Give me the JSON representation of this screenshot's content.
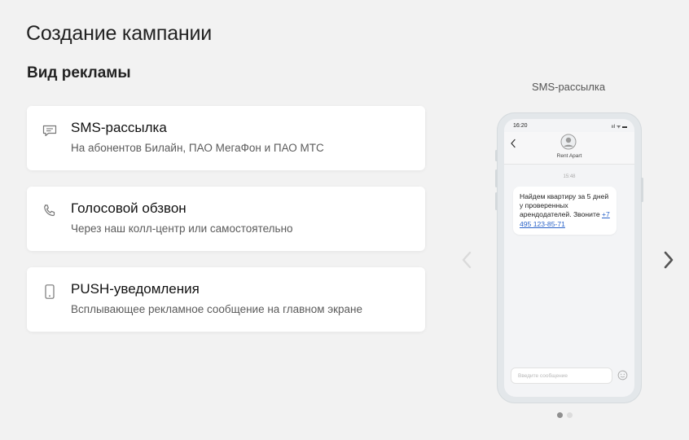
{
  "page": {
    "title": "Создание кампании",
    "section_title": "Вид рекламы"
  },
  "options": [
    {
      "title": "SMS-рассылка",
      "description": "На абонентов Билайн, ПАО МегаФон и ПАО МТС",
      "icon": "message-icon"
    },
    {
      "title": "Голосовой обзвон",
      "description": "Через наш колл-центр или самостоятельно",
      "icon": "phone-call-icon"
    },
    {
      "title": "PUSH-уведомления",
      "description": "Всплывающее рекламное сообщение на главном экране",
      "icon": "smartphone-icon"
    }
  ],
  "preview": {
    "label": "SMS-рассылка",
    "status_time": "16:20",
    "status_icons": "ııl ᯤ ▬",
    "contact_name": "Rent Apart",
    "message_time": "15:48",
    "message_text": "Найдем квартиру за 5 дней у проверенных арендодателей. Звоните",
    "message_phone": "+7 495 123-85-71",
    "input_placeholder": "Введите сообщение",
    "carousel_pages": 2,
    "carousel_active": 1
  },
  "colors": {
    "background": "#f2f2f2",
    "card": "#ffffff",
    "link": "#2a63c8",
    "phone_frame": "#e3e7ea"
  }
}
